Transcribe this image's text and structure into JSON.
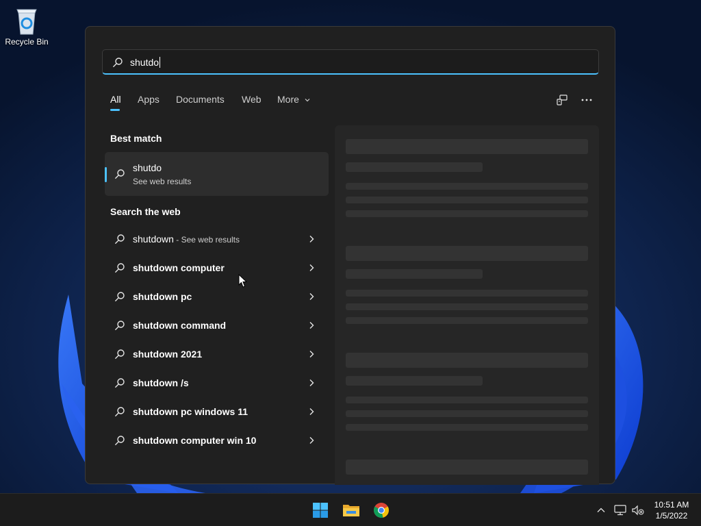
{
  "desktop": {
    "recycle_bin_label": "Recycle Bin"
  },
  "search": {
    "query": "shutdo"
  },
  "tabs": [
    {
      "label": "All",
      "active": true
    },
    {
      "label": "Apps"
    },
    {
      "label": "Documents"
    },
    {
      "label": "Web"
    },
    {
      "label": "More"
    }
  ],
  "toolbar": {
    "share_icon": "connected-devices-icon",
    "more_icon": "ellipsis-icon"
  },
  "best_match": {
    "heading": "Best match",
    "title": "shutdo",
    "subtitle": "See web results"
  },
  "web_search": {
    "heading": "Search the web",
    "items": [
      {
        "text": "shutdown",
        "suffix": " - See web results",
        "bold": false
      },
      {
        "text": "shutdown computer",
        "bold": true
      },
      {
        "text": "shutdown pc",
        "bold": true
      },
      {
        "text": "shutdown command",
        "bold": true
      },
      {
        "text": "shutdown 2021",
        "bold": true
      },
      {
        "text": "shutdown /s",
        "bold": true
      },
      {
        "text": "shutdown pc windows 11",
        "bold": true
      },
      {
        "text": "shutdown computer win 10",
        "bold": true
      }
    ]
  },
  "taskbar": {
    "apps": [
      "windows-start-icon",
      "file-explorer-icon",
      "chrome-icon"
    ],
    "tray": [
      "chevron-up-icon",
      "network-icon",
      "volume-muted-icon"
    ],
    "time": "10:51 AM",
    "date": "1/5/2022"
  },
  "colors": {
    "accent": "#4cc2ff",
    "panel_bg": "#202020",
    "taskbar_bg": "#1c1c1c"
  }
}
